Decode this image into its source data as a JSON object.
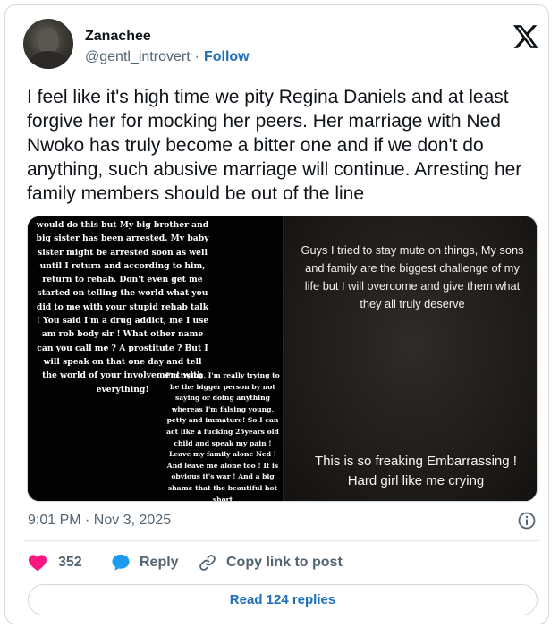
{
  "author": {
    "name": "Zanachee",
    "handle": "@gentl_introvert",
    "separator": "·",
    "follow_label": "Follow",
    "avatar_icon": "profile-photo"
  },
  "platform_icon": "x-logo",
  "tweet": {
    "text": "I feel like it's high time we pity Regina Daniels and at least forgive her for mocking her peers. Her marriage with Ned Nwoko has truly become a bitter one and if we don't do anything, such abusive marriage will continue. Arresting her family members should be out of the line"
  },
  "media": {
    "left_panel_text": "would do this but My big brother and big sister has been arrested. My baby sister might be arrested soon as well until I return and according to him, return to rehab. Don't even get me started on telling the world what you did to me with your stupid rehab talk ! You said I'm a drug addict, me I use am rob body sir ! What other name can you call me ? A prostitute ? But I will speak on that one day and tell the world of your involvement with everything!",
    "middle_text": "I'm trying, I'm really trying to be the bigger person by not saying or doing anything whereas I'm falsing young, petty and immature! So I can act like a fucking 25years old child and speak my pain ! Leave my family alone Ned ! And leave me alone too ! It is obvious it's war ! And a big shame that the beautiful hot short",
    "right_panel_text": "Guys I tried to stay mute on things, My sons and family are the biggest challenge of my life but I will overcome and give them what they all truly deserve",
    "caption": "This is so freaking Embarrassing ! Hard girl like me crying"
  },
  "meta": {
    "timestamp": "9:01 PM · Nov 3, 2025",
    "info_icon": "info-icon"
  },
  "actions": {
    "likes": "352",
    "reply_label": "Reply",
    "copy_label": "Copy link to post"
  },
  "read_replies_label": "Read 124 replies",
  "colors": {
    "like": "#f91880",
    "reply": "#1d9bf0",
    "link": "#1d6fb9",
    "muted": "#536471",
    "border": "#cfd9de"
  }
}
